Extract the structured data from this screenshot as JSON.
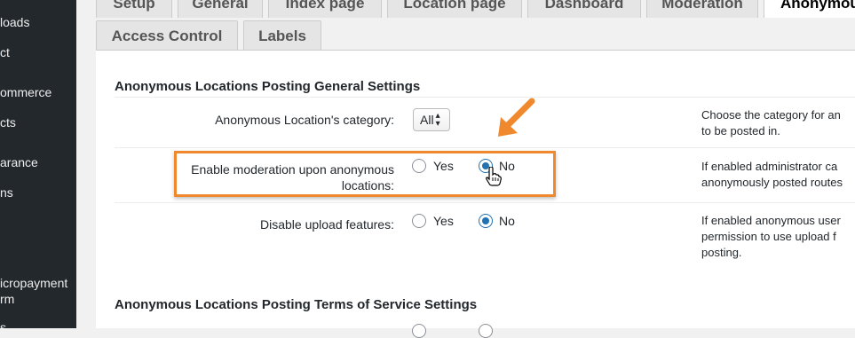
{
  "sidebar": {
    "items": [
      {
        "label": "loads"
      },
      {
        "label": "ct"
      },
      {
        "label": "ommerce"
      },
      {
        "label": "cts"
      },
      {
        "label": "arance"
      },
      {
        "label": "ns"
      },
      {
        "label": "icropayment"
      },
      {
        "label": "rm"
      },
      {
        "label": "s"
      }
    ]
  },
  "tabs": {
    "row1": [
      {
        "label": "Setup"
      },
      {
        "label": "General"
      },
      {
        "label": "Index page"
      },
      {
        "label": "Location page"
      },
      {
        "label": "Dashboard"
      },
      {
        "label": "Moderation"
      },
      {
        "label": "Anonymou"
      }
    ],
    "row2": [
      {
        "label": "Access Control"
      },
      {
        "label": "Labels"
      }
    ]
  },
  "section1": {
    "title": "Anonymous Locations Posting General Settings"
  },
  "rows": {
    "category": {
      "label": "Anonymous Location's category:",
      "select_value": "All",
      "description_line1": "Choose the category for an",
      "description_line2": "to be posted in."
    },
    "moderation": {
      "label_line1": "Enable moderation upon anonymous",
      "label_line2": "locations:",
      "yes": "Yes",
      "no": "No",
      "selected": "No",
      "description_line1": "If enabled administrator ca",
      "description_line2": "anonymously posted routes"
    },
    "upload": {
      "label": "Disable upload features:",
      "yes": "Yes",
      "no": "No",
      "selected": "No",
      "description_line1": "If enabled anonymous user",
      "description_line2": "permission to use upload f",
      "description_line3": "posting."
    }
  },
  "section2": {
    "title": "Anonymous Locations Posting Terms of Service Settings"
  },
  "colors": {
    "sidebar_bg": "#23282d",
    "highlight": "#f0892e",
    "radio_checked": "#2271b1"
  }
}
